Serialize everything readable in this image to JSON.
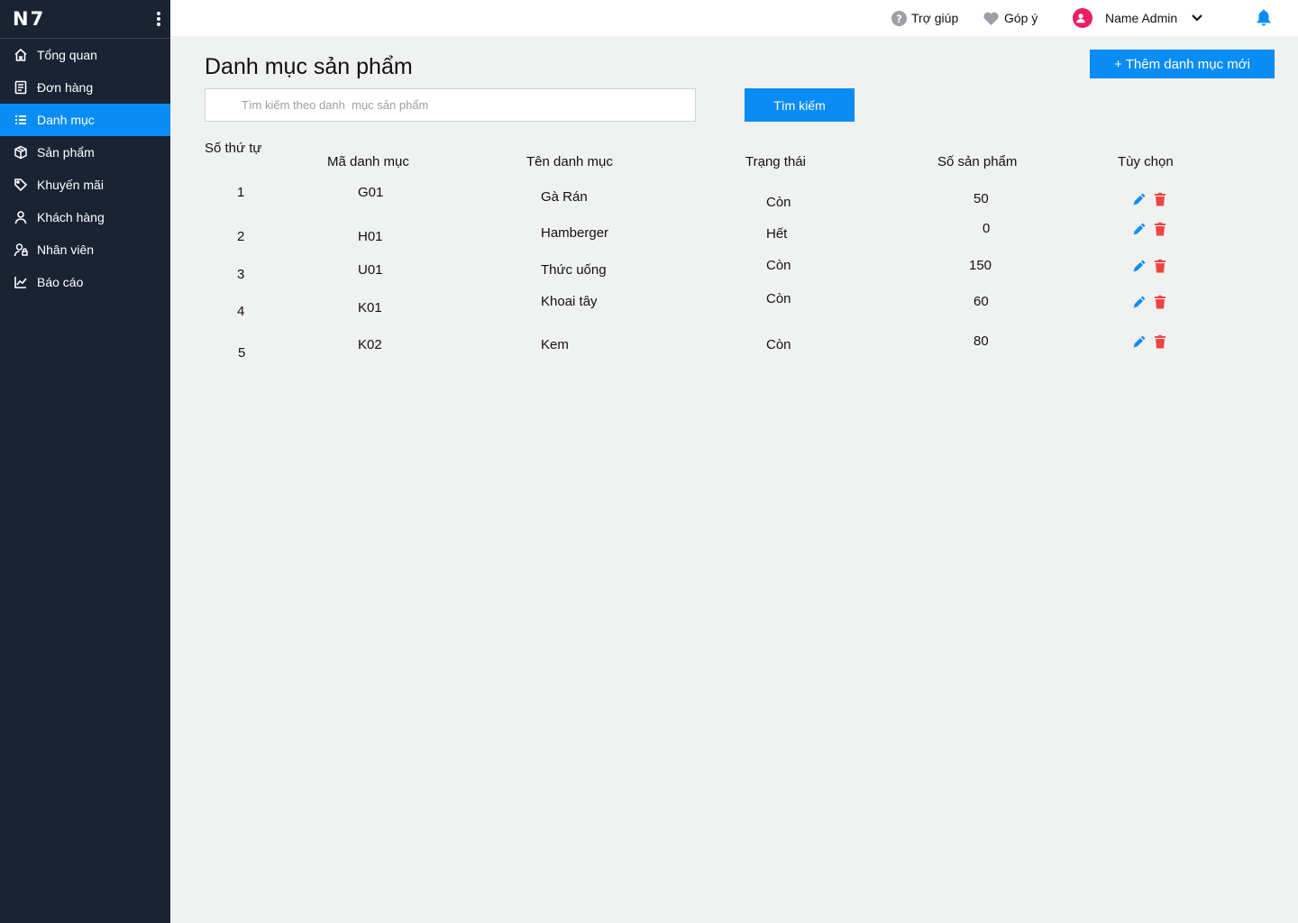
{
  "brand": {
    "logo": "N7"
  },
  "sidebar": {
    "items": [
      {
        "label": "Tổng quan",
        "icon": "home-icon"
      },
      {
        "label": "Đơn hàng",
        "icon": "receipt-icon"
      },
      {
        "label": "Danh mục",
        "icon": "list-icon",
        "active": true
      },
      {
        "label": "Sản phẩm",
        "icon": "box-icon"
      },
      {
        "label": "Khuyến mãi",
        "icon": "tag-icon"
      },
      {
        "label": "Khách hàng",
        "icon": "user-icon"
      },
      {
        "label": "Nhân viên",
        "icon": "user-lock-icon"
      },
      {
        "label": "Báo cáo",
        "icon": "chart-line-icon"
      }
    ]
  },
  "topbar": {
    "help_label": "Trợ giúp",
    "feedback_label": "Góp ý",
    "user_name": "Name Admin"
  },
  "main": {
    "title": "Danh mục sản phẩm",
    "add_button": "+ Thêm danh mục mới",
    "search_placeholder": "Tìm kiếm theo danh  mục sản phẩm",
    "search_button": "Tìm kiếm",
    "columns": [
      "Số thứ tự",
      "Mã danh mục",
      "Tên danh mục",
      "Trạng thái",
      "Số sản phẩm",
      "Tùy chọn"
    ],
    "rows": [
      [
        "1",
        "G01",
        "Gà Rán",
        "Còn",
        "50"
      ],
      [
        "2",
        "H01",
        "Hamberger",
        "Hết",
        "0"
      ],
      [
        "3",
        "U01",
        "Thức uống",
        "Còn",
        "150"
      ],
      [
        "4",
        "K01",
        "Khoai tây",
        "Còn",
        "60"
      ],
      [
        "5",
        "K02",
        "Kem",
        "Còn",
        "80"
      ]
    ]
  },
  "colors": {
    "sidebar_bg": "#192334",
    "accent": "#0a8cf5",
    "delete": "#f04444",
    "avatar": "#e91e63",
    "page_bg": "#f0f1f1"
  }
}
